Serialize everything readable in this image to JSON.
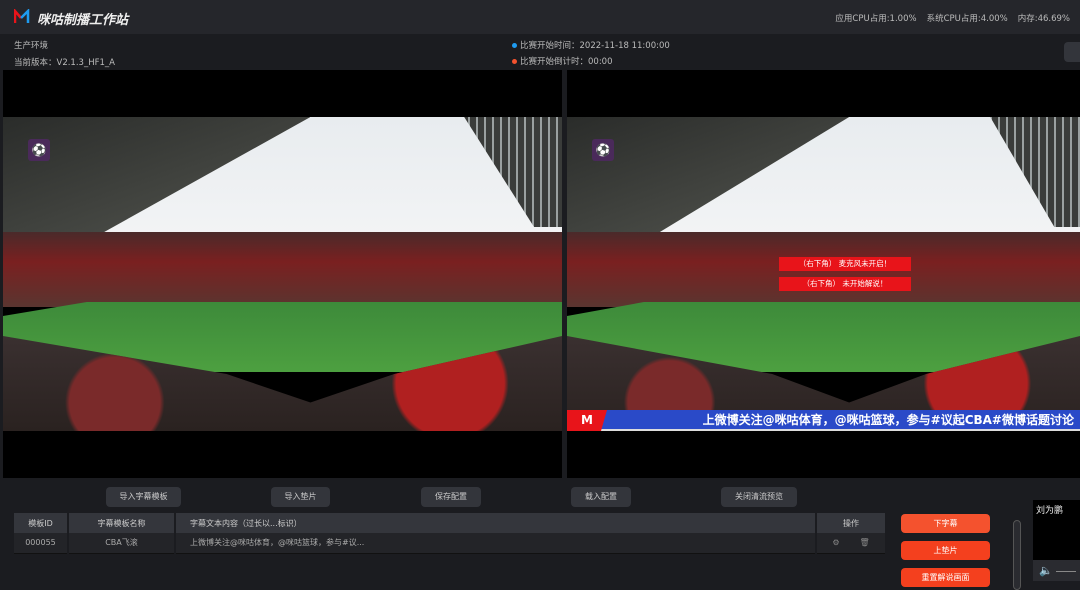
{
  "header": {
    "title": "咪咕制播工作站",
    "logo_icon": "migu-logo-icon",
    "stats": [
      "应用CPU占用:1.00%",
      "系统CPU占用:4.00%",
      "内存:46.69%"
    ]
  },
  "info": {
    "env": "生产环境",
    "version": "当前版本：V2.1.3_HF1_A",
    "start_time": "比赛开始时间：2022-11-18 11:00:00",
    "countdown": "比赛开始倒计时：00:00",
    "colors": {
      "blue": "#1e9bf0",
      "red": "#f4522e"
    }
  },
  "preview": {
    "warnings": [
      "（右下角） 麦克风未开启！",
      "（右下角） 未开始解说！"
    ],
    "ticker": "上微博关注@咪咕体育，@咪咕篮球，参与#议起CBA#微博话题讨论"
  },
  "toolbar": {
    "import_template": "导入字幕模板",
    "import_pad": "导入垫片",
    "save_config": "保存配置",
    "load_config": "载入配置",
    "close_preview": "关闭清流预览"
  },
  "table": {
    "headers": [
      "模板ID",
      "字幕模板名称",
      "字幕文本内容（过长以...标识）",
      "操作"
    ],
    "rows": [
      {
        "id": "000055",
        "name": "CBA飞滚",
        "text": "上微博关注@咪咕体育，@咪咕篮球，参与#议..."
      }
    ]
  },
  "actions": {
    "subtitle_down": "下字幕",
    "pad_up": "上垫片",
    "reset": "重置解说画面"
  },
  "commentator": {
    "name": "刘为鹏"
  }
}
